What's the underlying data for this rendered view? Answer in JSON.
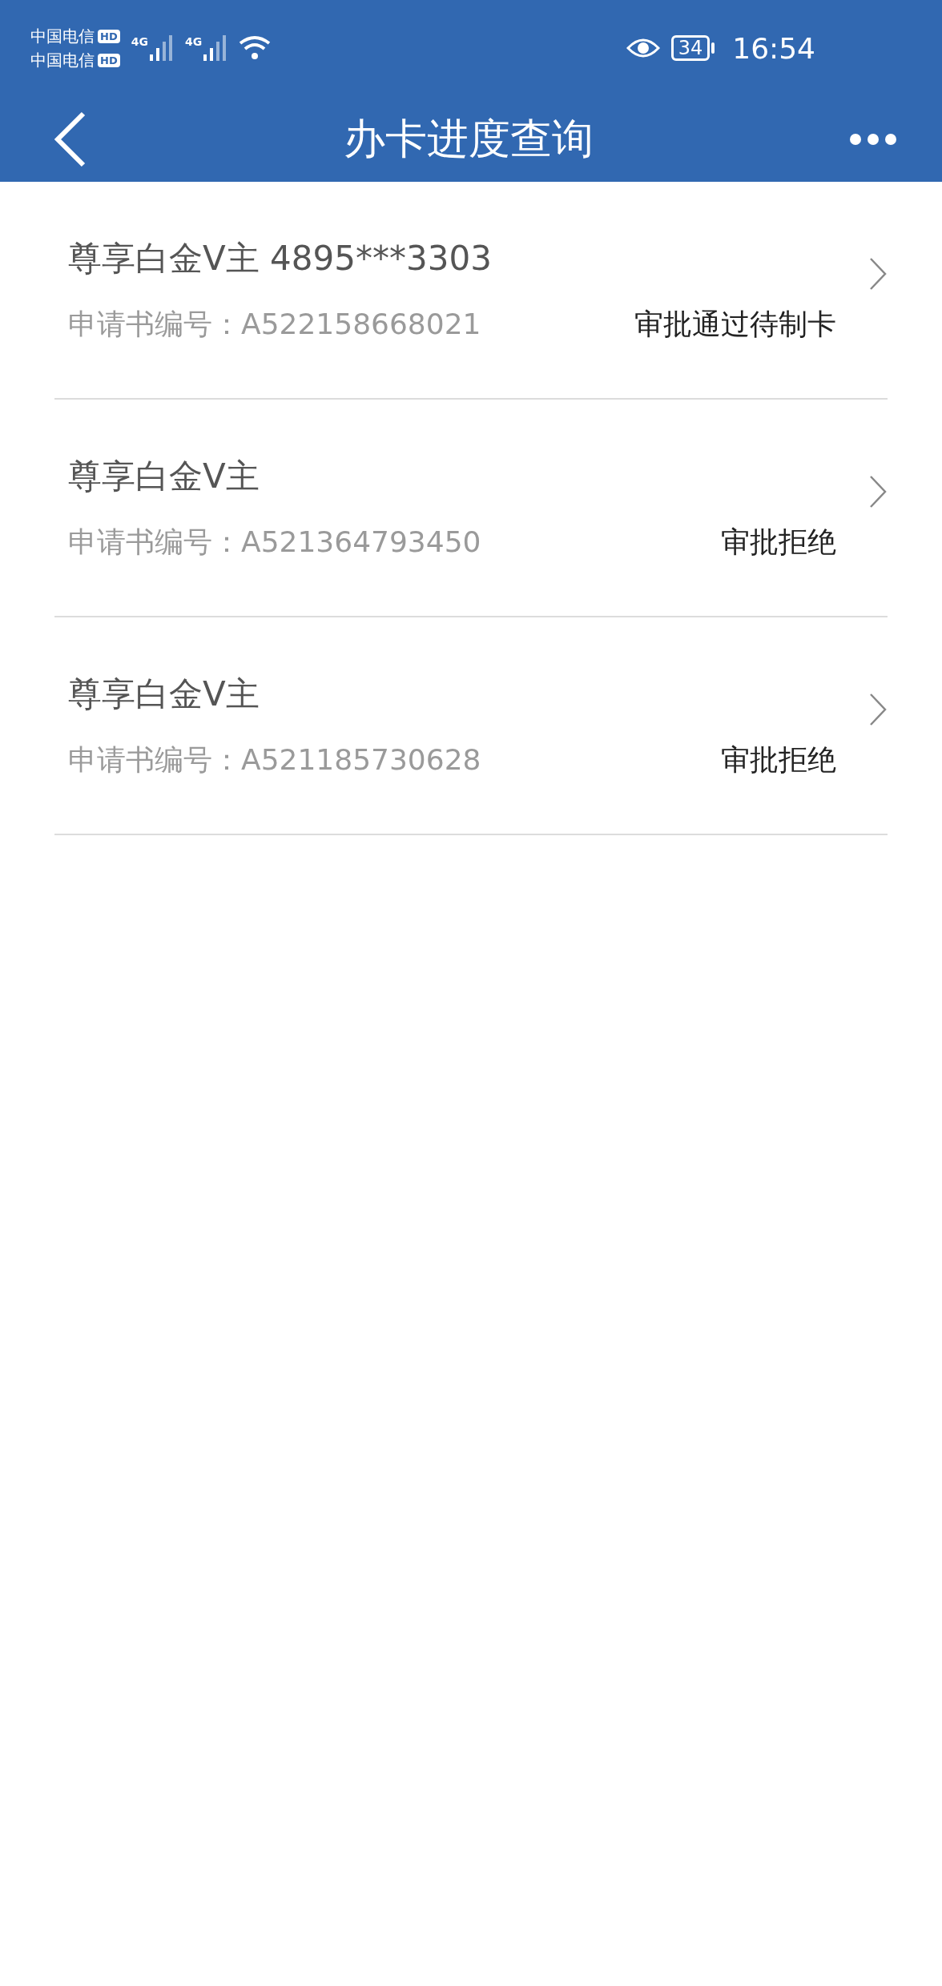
{
  "status_bar": {
    "carriers": [
      {
        "name": "中国电信",
        "badge": "HD"
      },
      {
        "name": "中国电信",
        "badge": "HD"
      }
    ],
    "network": [
      "4G",
      "4G"
    ],
    "battery": "34",
    "time": "16:54"
  },
  "header": {
    "title": "办卡进度查询"
  },
  "applications": [
    {
      "card": "尊享白金V主 4895***3303",
      "number_label": "申请书编号：",
      "number": "A522158668021",
      "status": "审批通过待制卡"
    },
    {
      "card": "尊享白金V主",
      "number_label": "申请书编号：",
      "number": "A521364793450",
      "status": "审批拒绝"
    },
    {
      "card": "尊享白金V主",
      "number_label": "申请书编号：",
      "number": "A521185730628",
      "status": "审批拒绝"
    }
  ]
}
